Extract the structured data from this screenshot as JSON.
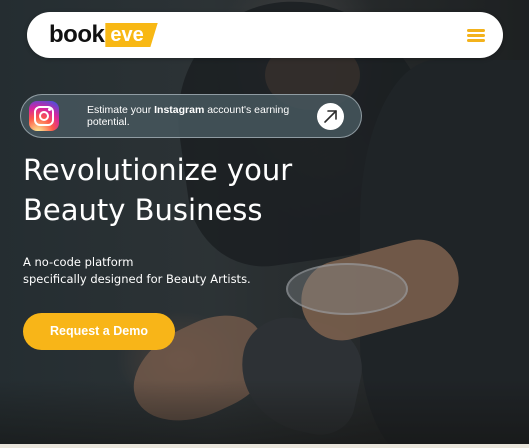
{
  "header": {
    "logo_part1": "book",
    "logo_part2": "eve",
    "menu_icon": "hamburger-menu-icon",
    "accent_color": "#f8b814"
  },
  "promo": {
    "icon": "instagram-icon",
    "text_prefix": "Estimate your ",
    "text_bold": "Instagram",
    "text_suffix": " account's earning potential.",
    "arrow_icon": "arrow-up-right-icon"
  },
  "hero": {
    "headline_line1": "Revolutionize your",
    "headline_line2": "Beauty Business",
    "subtext_line1": "A no-code platform",
    "subtext_line2": "specifically designed for Beauty Artists.",
    "cta_label": "Request a Demo"
  }
}
